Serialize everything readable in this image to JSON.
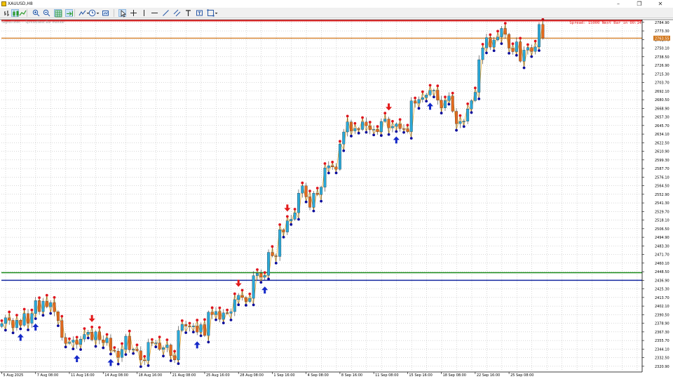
{
  "window": {
    "title": "XAUUSD,H8",
    "minimize_glyph": "–",
    "restore_glyph": "❐",
    "close_glyph": "✕"
  },
  "toolbar": {
    "buttons": [
      {
        "name": "bar-chart-icon"
      },
      {
        "name": "candlestick-icon",
        "selected": true
      },
      {
        "name": "line-chart-icon"
      },
      {
        "name": "zoom-in-icon"
      },
      {
        "name": "zoom-out-icon"
      },
      {
        "name": "grid-icon",
        "selected": true
      },
      {
        "name": "autoscroll-icon",
        "selected": true
      },
      {
        "name": "indicators-icon",
        "dropdown": true
      },
      {
        "name": "periods-icon",
        "dropdown": true
      },
      {
        "name": "templates-icon"
      },
      {
        "name": "cursor-icon",
        "selected": true
      },
      {
        "name": "crosshair-icon"
      },
      {
        "name": "vertical-line-icon"
      },
      {
        "name": "horizontal-line-icon"
      },
      {
        "name": "trendline-icon"
      },
      {
        "name": "channel-icon"
      },
      {
        "name": "text-icon"
      },
      {
        "name": "text-label-icon"
      },
      {
        "name": "shapes-icon",
        "dropdown": true
      }
    ]
  },
  "indicator_header": "Signal lines — Spread/Next Bar monitor",
  "info_text": "Spread: 15000 Next Bar in 00:14",
  "current_price_label": "2763.55",
  "colors": {
    "bull": "#29a8d8",
    "bear": "#e46a1e",
    "high_dot": "#e0141e",
    "low_dot": "#0b0b9c",
    "zigzag": "#e8a317",
    "grid": "#b0b0b0",
    "line_red": "#e31919",
    "line_orange": "#d2781e",
    "line_green": "#1a8a1a",
    "line_blue": "#1428a0",
    "up_arrow": "#1428c8",
    "down_arrow": "#e31919"
  },
  "chart_data": {
    "type": "candlestick",
    "symbol": "XAUUSD",
    "timeframe": "H8",
    "ylim": [
      2315.1,
      2788.5
    ],
    "y_ticks": [
      2320.9,
      2332.5,
      2344.1,
      2355.7,
      2367.3,
      2378.9,
      2390.5,
      2402.1,
      2413.7,
      2425.3,
      2436.9,
      2448.5,
      2460.1,
      2471.7,
      2483.3,
      2494.9,
      2506.5,
      2518.1,
      2529.7,
      2541.3,
      2552.9,
      2564.5,
      2576.1,
      2587.7,
      2599.3,
      2610.9,
      2622.5,
      2634.1,
      2645.7,
      2657.3,
      2668.9,
      2680.5,
      2692.1,
      2703.7,
      2715.3,
      2726.9,
      2738.5,
      2750.1,
      2761.7,
      2773.3,
      2784.9
    ],
    "x_ticks": [
      {
        "bar": 0,
        "label": "5 Aug 2025"
      },
      {
        "bar": 9,
        "label": "7 Aug 08:00"
      },
      {
        "bar": 18,
        "label": "11 Aug 16:00"
      },
      {
        "bar": 27,
        "label": "14 Aug 08:00"
      },
      {
        "bar": 36,
        "label": "18 Aug 16:00"
      },
      {
        "bar": 45,
        "label": "21 Aug 08:00"
      },
      {
        "bar": 54,
        "label": "25 Aug 16:00"
      },
      {
        "bar": 63,
        "label": "28 Aug 08:00"
      },
      {
        "bar": 72,
        "label": "1 Sep 16:00"
      },
      {
        "bar": 81,
        "label": "4 Sep 08:00"
      },
      {
        "bar": 90,
        "label": "8 Sep 16:00"
      },
      {
        "bar": 99,
        "label": "11 Sep 08:00"
      },
      {
        "bar": 108,
        "label": "15 Sep 16:00"
      },
      {
        "bar": 117,
        "label": "18 Sep 08:00"
      },
      {
        "bar": 126,
        "label": "22 Sep 16:00"
      },
      {
        "bar": 135,
        "label": "25 Sep 08:00"
      }
    ],
    "hlines": [
      {
        "name": "resistance-line-red",
        "price": 2787.2,
        "color": "#e31919",
        "width": 2
      },
      {
        "name": "price-line-orange",
        "price": 2763.55,
        "color": "#d2781e",
        "width": 1.3
      },
      {
        "name": "support-line-green",
        "price": 2447.2,
        "color": "#1a8a1a",
        "width": 1.5
      },
      {
        "name": "support-line-blue",
        "price": 2436.9,
        "color": "#1428a0",
        "width": 1.5
      }
    ],
    "closes": [
      2378.5,
      2386.3,
      2382.9,
      2372.9,
      2383.0,
      2376.2,
      2392.0,
      2378.9,
      2392.0,
      2409.5,
      2394.6,
      2408.8,
      2401.1,
      2406.9,
      2394.4,
      2382.5,
      2359.7,
      2351.8,
      2353.2,
      2356.3,
      2350.4,
      2357.6,
      2363.9,
      2367.0,
      2356.6,
      2367.4,
      2356.6,
      2352.7,
      2359.0,
      2342.3,
      2341.5,
      2332.8,
      2343.6,
      2361.5,
      2343.1,
      2343.9,
      2341.8,
      2329.3,
      2328.7,
      2353.2,
      2352.0,
      2352.5,
      2343.6,
      2346.0,
      2349.7,
      2335.3,
      2329.4,
      2369.2,
      2377.5,
      2375.1,
      2374.0,
      2375.3,
      2367.0,
      2377.1,
      2362.4,
      2394.0,
      2390.5,
      2394.8,
      2384.2,
      2393.0,
      2392.3,
      2394.6,
      2410.8,
      2416.6,
      2413.7,
      2408.1,
      2412.6,
      2443.2,
      2446.4,
      2441.0,
      2443.5,
      2474.6,
      2469.9,
      2469.0,
      2505.1,
      2502.0,
      2517.1,
      2519.2,
      2528.0,
      2554.5,
      2564.4,
      2549.5,
      2535.3,
      2554.4,
      2552.5,
      2562.5,
      2588.5,
      2591.5,
      2589.9,
      2586.6,
      2620.6,
      2637.0,
      2650.5,
      2638.4,
      2641.7,
      2640.3,
      2650.5,
      2645.4,
      2639.9,
      2640.5,
      2637.1,
      2651.2,
      2654.5,
      2642.5,
      2644.5,
      2647.9,
      2641.4,
      2641.3,
      2637.4,
      2679.0,
      2675.8,
      2680.8,
      2683.4,
      2686.9,
      2693.1,
      2693.3,
      2679.8,
      2669.4,
      2679.3,
      2685.5,
      2664.9,
      2648.2,
      2651.2,
      2651.5,
      2668.1,
      2679.2,
      2690.5,
      2734.5,
      2750.5,
      2764.3,
      2751.5,
      2761.1,
      2765.1,
      2776.7,
      2768.7,
      2750.1,
      2745.3,
      2758.6,
      2732.4,
      2747.4,
      2751.0,
      2745.6,
      2751.7,
      2782.0,
      2763.6
    ],
    "up_arrows": [
      5,
      9,
      20,
      29,
      52,
      70,
      105,
      114
    ],
    "down_arrows": [
      24,
      63,
      76,
      103
    ]
  }
}
